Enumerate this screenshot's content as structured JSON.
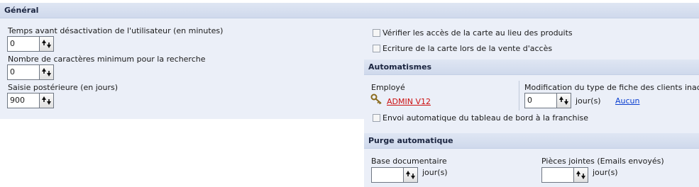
{
  "general": {
    "header": "Général",
    "inactivity": {
      "label": "Temps avant désactivation de l'utilisateur (en minutes)",
      "value": "0"
    },
    "min_chars": {
      "label": "Nombre de caractères minimum pour la recherche",
      "value": "0"
    },
    "posterior": {
      "label": "Saisie postérieure (en jours)",
      "value": "900"
    },
    "check_card_access": {
      "label": "Vérifier les accès de la carte au lieu des produits",
      "checked": false
    },
    "write_card_on_sale": {
      "label": "Ecriture de la carte lors de la vente d'accès",
      "checked": false
    }
  },
  "automatismes": {
    "header": "Automatismes",
    "employee_label": "Employé",
    "employee_name": "ADMIN V12",
    "inactive_clients": {
      "label": "Modification du type de fiche des clients inactifs",
      "value": "0",
      "unit": "jour(s)",
      "none_link": "Aucun"
    },
    "send_dashboard": {
      "label": "Envoi automatique du tableau de bord à la franchise",
      "checked": false
    }
  },
  "purge": {
    "header": "Purge automatique",
    "documents": {
      "label": "Base documentaire",
      "value": "",
      "unit": "jour(s)"
    },
    "attachments": {
      "label": "Pièces jointes (Emails envoyés)",
      "value": "",
      "unit": "jour(s)"
    }
  },
  "icons": {
    "employee": "key-icon",
    "spin": "spinner-arrows-icon"
  }
}
